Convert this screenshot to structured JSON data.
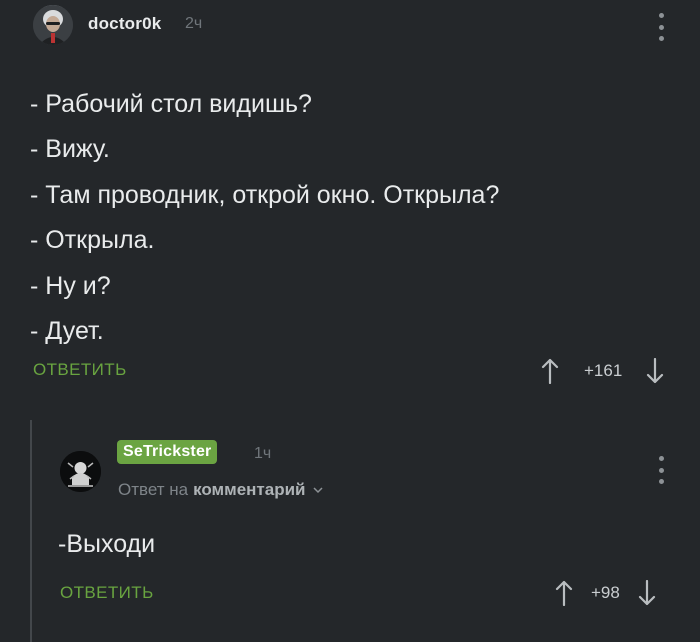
{
  "post": {
    "username": "doctor0k",
    "time": "2ч",
    "lines": [
      "- Рабочий стол видишь?",
      "- Вижу.",
      "- Там проводник, открой окно. Открыла?",
      "- Открыла.",
      "- Ну и?",
      "- Дует."
    ],
    "reply_label": "ОТВЕТИТЬ",
    "score": "+161",
    "upvote_icon": "arrow-up-icon",
    "downvote_icon": "arrow-down-icon",
    "menu_icon": "more-vertical-icon"
  },
  "reply": {
    "username": "SeTrickster",
    "time": "1ч",
    "reply_to_prefix": "Ответ на",
    "reply_to_target": "комментарий",
    "text": "-Выходи",
    "reply_label": "ОТВЕТИТЬ",
    "score": "+98",
    "chevron_icon": "chevron-down-icon"
  },
  "colors": {
    "background": "#24272a",
    "accent_green": "#69a440",
    "text": "#e9ebec",
    "muted": "#70767b"
  }
}
